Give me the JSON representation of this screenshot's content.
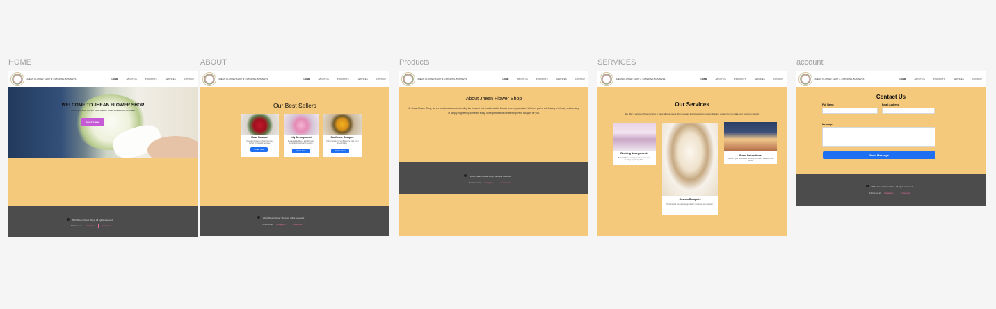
{
  "labels": {
    "home": "HOME",
    "about": "ABOUT",
    "products": "Products",
    "services": "SERVICES",
    "account": "account"
  },
  "brand": "JHEAN FLOWER SHOP & CATERING BUSINESS",
  "menu": [
    "HOME",
    "ABOUT US",
    "PRODUCTS",
    "SERVICES",
    "CONTACT"
  ],
  "footer": {
    "copyright": "2024 Jhean Flower Shop. All rights reserved.",
    "follow": "Follow us at",
    "links": [
      "Instagram",
      "Facebook"
    ]
  },
  "home": {
    "title": "WELCOME TO JHEAN FLOWER SHOP",
    "subtitle": "YOUR SOURCE OF NATURAL BEAUTY AND ELEGANCE FLOWER",
    "button": "SHOP NOW"
  },
  "about_page": {
    "title": "Our Best Sellers",
    "cards": [
      {
        "name": "Rose Bouquet",
        "desc": "A beautiful bouquet of fresh red roses, perfect for romantic gestures.",
        "button": "Order now"
      },
      {
        "name": "Lily Arrangement",
        "desc": "Elegant white lilies in a stylish vase, symbolizing purity and devotion.",
        "button": "Order Now"
      },
      {
        "name": "Sunflower Bouquet",
        "desc": "A bright bouquet of sunflowers to bring joy to anyone's day.",
        "button": "Order Now"
      }
    ]
  },
  "products_page": {
    "title": "About  Jhean Flower Shop",
    "text": "At Jhean Flower Shop, we are passionate about providing the freshest and most beautiful flowers for every occasion. Whether you're celebrating a birthday, anniversary, or simply brightening someone's day, our expert florists create the perfect bouquet for you."
  },
  "services_page": {
    "title": "Our Services",
    "text": "We offer a variety of floral services to meet all your needs. From elegant arrangements to custom designs, we are here to make your moments special.",
    "cards": [
      {
        "name": "Wedding Arrangements",
        "desc": "Beautiful flower arrangements to make your wedding day unforgettable."
      },
      {
        "name": "Custom Bouquets",
        "desc": "Personalized bouquets designed with care to suit any occasion."
      },
      {
        "name": "Event Decorations",
        "desc": "Transform your events with stunning floral decor tailored to your theme."
      }
    ]
  },
  "account_page": {
    "title": "Contact Us",
    "fields": {
      "name": "Full Name",
      "email": "Email Address",
      "message": "Message"
    },
    "button": "Send Message"
  },
  "colors": {
    "page": "#f4c97c",
    "footer": "#4c4c4c",
    "accent_button": "#1e6ff2",
    "shop_button": "#c65bd6",
    "link": "#e46aa0"
  }
}
